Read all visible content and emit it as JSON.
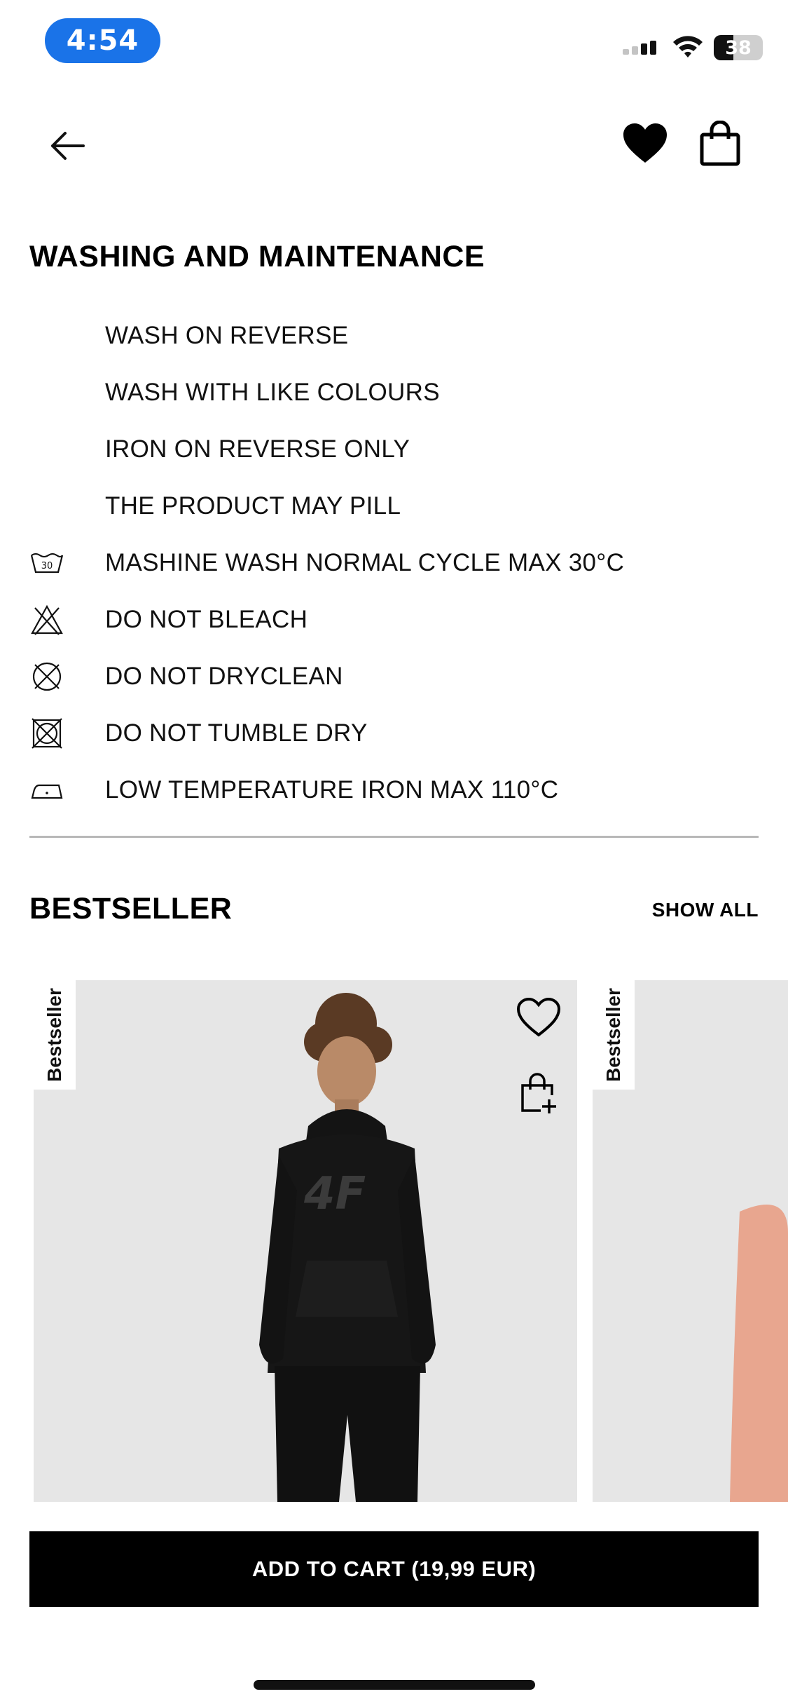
{
  "status_bar": {
    "time": "4:54",
    "battery": "38",
    "icons": [
      "cellular-signal-icon",
      "wifi-icon",
      "battery-icon"
    ]
  },
  "header": {
    "icons": [
      "back-arrow-icon",
      "heart-icon",
      "shopping-bag-icon"
    ]
  },
  "care": {
    "title": "WASHING AND MAINTENANCE",
    "items": [
      {
        "label": "WASH ON REVERSE",
        "icon": null
      },
      {
        "label": "WASH WITH LIKE COLOURS",
        "icon": null
      },
      {
        "label": "IRON ON REVERSE ONLY",
        "icon": null
      },
      {
        "label": "THE PRODUCT MAY PILL",
        "icon": null
      },
      {
        "label": "MASHINE WASH NORMAL CYCLE MAX 30°C",
        "icon": "wash-30-icon",
        "icon_text": "30"
      },
      {
        "label": "DO NOT BLEACH",
        "icon": "no-bleach-icon"
      },
      {
        "label": "DO NOT DRYCLEAN",
        "icon": "no-dryclean-icon"
      },
      {
        "label": "DO NOT TUMBLE DRY",
        "icon": "no-tumble-dry-icon"
      },
      {
        "label": "LOW TEMPERATURE IRON MAX 110°C",
        "icon": "low-iron-icon"
      }
    ]
  },
  "bestseller": {
    "title": "BESTSELLER",
    "show_all": "SHOW ALL",
    "products": [
      {
        "badge": "Bestseller",
        "logo_text": "4F",
        "icons": [
          "heart-outline-icon",
          "add-to-bag-icon"
        ]
      },
      {
        "badge": "Bestseller"
      }
    ]
  },
  "cart": {
    "button_label": "ADD TO CART (19,99 EUR)"
  },
  "colors": {
    "status_pill": "#1a73e8",
    "card_background": "#e6e6e6",
    "button_background": "#000000"
  }
}
